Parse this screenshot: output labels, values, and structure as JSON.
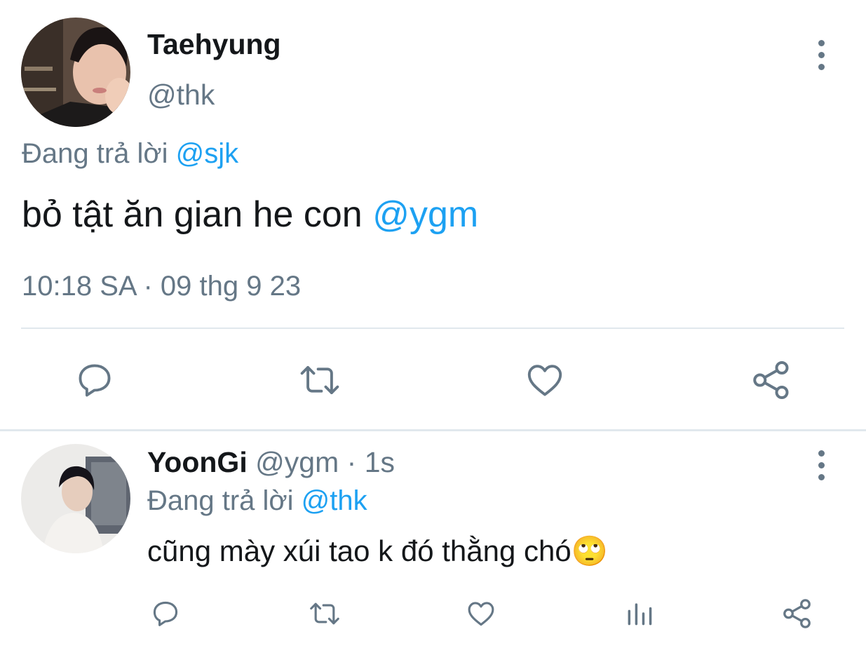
{
  "tweet": {
    "author_name": "Taehyung",
    "handle": "@thk",
    "reply_prefix": "Đang trả lời",
    "reply_to": "@sjk",
    "text": "bỏ tật ăn gian he con",
    "text_mention": "@ygm",
    "timestamp": "10:18 SA · 09 thg 9 23",
    "actions": [
      "reply-icon",
      "retweet-icon",
      "like-icon",
      "share-icon"
    ]
  },
  "reply": {
    "author_name": "YoonGi",
    "handle": "@ygm",
    "separator": "·",
    "time": "1s",
    "reply_prefix": "Đang trả lời",
    "reply_to": "@thk",
    "text": "cũng mày xúi tao k đó thằng chó",
    "emoji": "🙄",
    "actions": [
      "reply-icon",
      "retweet-icon",
      "like-icon",
      "analytics-icon",
      "share-icon"
    ]
  },
  "colors": {
    "text": "#14171a",
    "secondary": "#657786",
    "link": "#1da1f2",
    "divider": "#e1e8ed"
  }
}
